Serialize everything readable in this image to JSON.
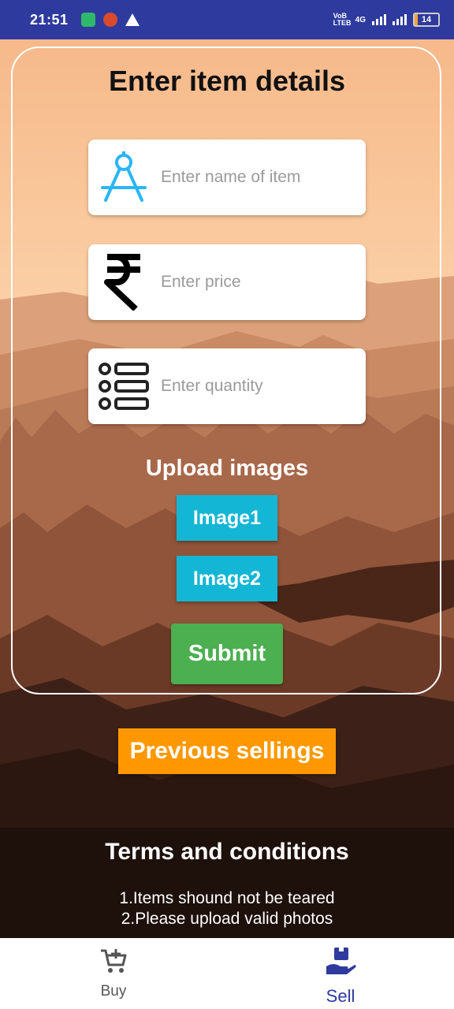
{
  "status_bar": {
    "time": "21:51",
    "network_label": "4G",
    "volte_label": "VoB LTEB",
    "battery_level": "14"
  },
  "form": {
    "title": "Enter item details",
    "fields": [
      {
        "placeholder": "Enter name of item",
        "icon": "compass-icon"
      },
      {
        "placeholder": "Enter price",
        "icon": "rupee-icon"
      },
      {
        "placeholder": "Enter quantity",
        "icon": "list-icon"
      }
    ],
    "upload_title": "Upload images",
    "image1_label": "Image1",
    "image2_label": "Image2",
    "submit_label": "Submit"
  },
  "previous_sellings_label": "Previous sellings",
  "terms": {
    "title": "Terms and conditions",
    "lines": [
      "1.Items shound not be teared",
      "2.Please upload valid photos"
    ]
  },
  "bottom_nav": {
    "items": [
      {
        "label": "Buy",
        "icon": "cart-icon"
      },
      {
        "label": "Sell",
        "icon": "hand-box-icon",
        "active": true
      }
    ]
  },
  "colors": {
    "status_bar": "#2e3a9e",
    "image_button": "#13b6d4",
    "submit_button": "#4caf50",
    "previous_button": "#ff9800",
    "active_nav": "#2e3a9e"
  }
}
